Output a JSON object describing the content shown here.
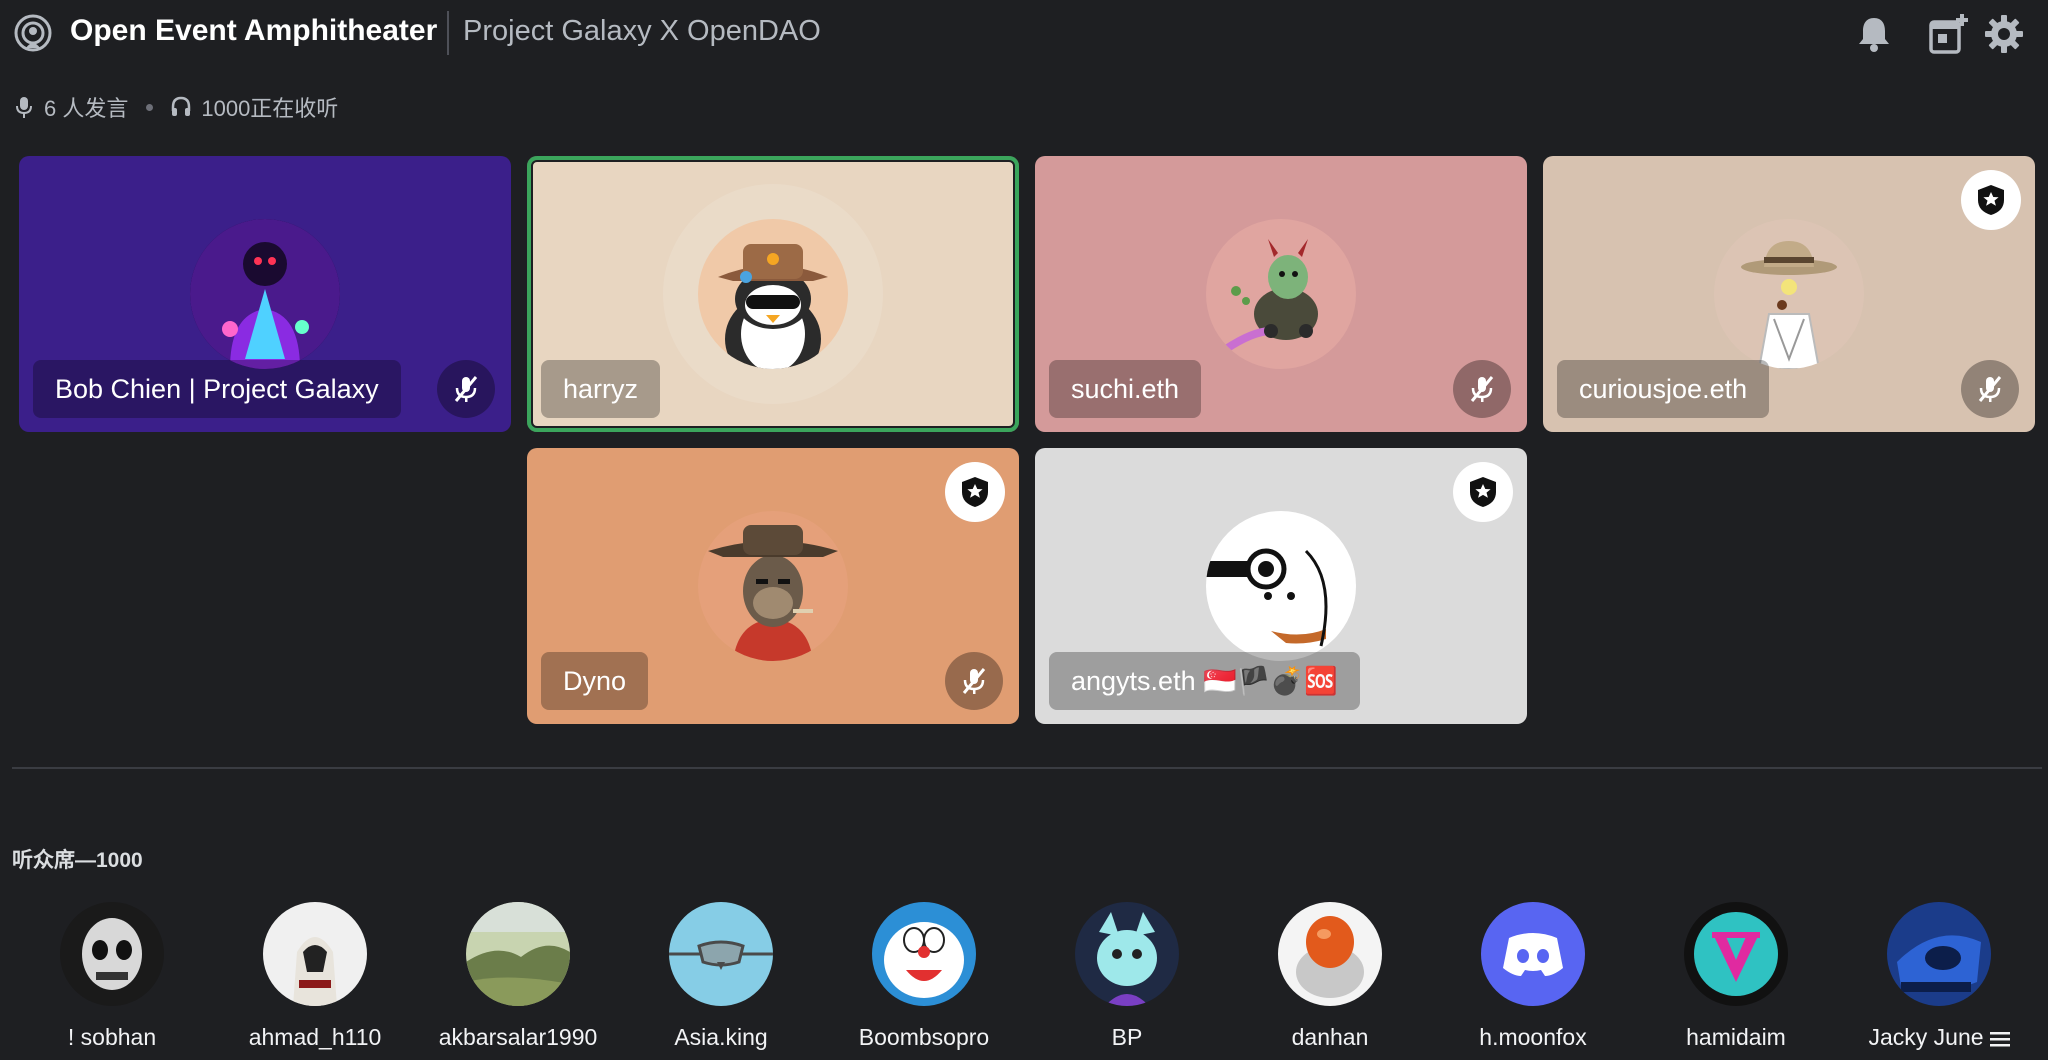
{
  "header": {
    "title": "Open Event Amphitheater",
    "subtitle": "Project Galaxy X OpenDAO"
  },
  "stats": {
    "speakers": "6 人发言",
    "listeners": "1000正在收听"
  },
  "speakers": [
    {
      "name": "Bob Chien | Project Galaxy",
      "bg": "#3b1f8a",
      "muted": true,
      "moderator": false,
      "speaking": false
    },
    {
      "name": "harryz",
      "bg": "#e8d6c1",
      "muted": false,
      "moderator": false,
      "speaking": true
    },
    {
      "name": "suchi.eth",
      "bg": "#d49a9a",
      "muted": true,
      "moderator": false,
      "speaking": false
    },
    {
      "name": "curiousjoe.eth",
      "bg": "#d7c2b0",
      "muted": true,
      "moderator": true,
      "speaking": false
    },
    {
      "name": "Dyno",
      "bg": "#e09d72",
      "muted": true,
      "moderator": true,
      "speaking": false
    },
    {
      "name": "angyts.eth 🇸🇬🏴💣🆘",
      "bg": "#dbdbdb",
      "muted": false,
      "moderator": true,
      "speaking": false
    }
  ],
  "audience": {
    "header": "听众席—1000",
    "members": [
      {
        "name": "! sobhan"
      },
      {
        "name": "ahmad_h110"
      },
      {
        "name": "akbarsalar1990"
      },
      {
        "name": "Asia.king"
      },
      {
        "name": "Boombsopro"
      },
      {
        "name": "BP"
      },
      {
        "name": "danhan"
      },
      {
        "name": "h.moonfox"
      },
      {
        "name": "hamidaim"
      },
      {
        "name": "Jacky June"
      }
    ]
  },
  "colors": {
    "background": "#1e1f22",
    "speaking_ring": "#3ba55c",
    "discord_blurple": "#5865f2"
  }
}
